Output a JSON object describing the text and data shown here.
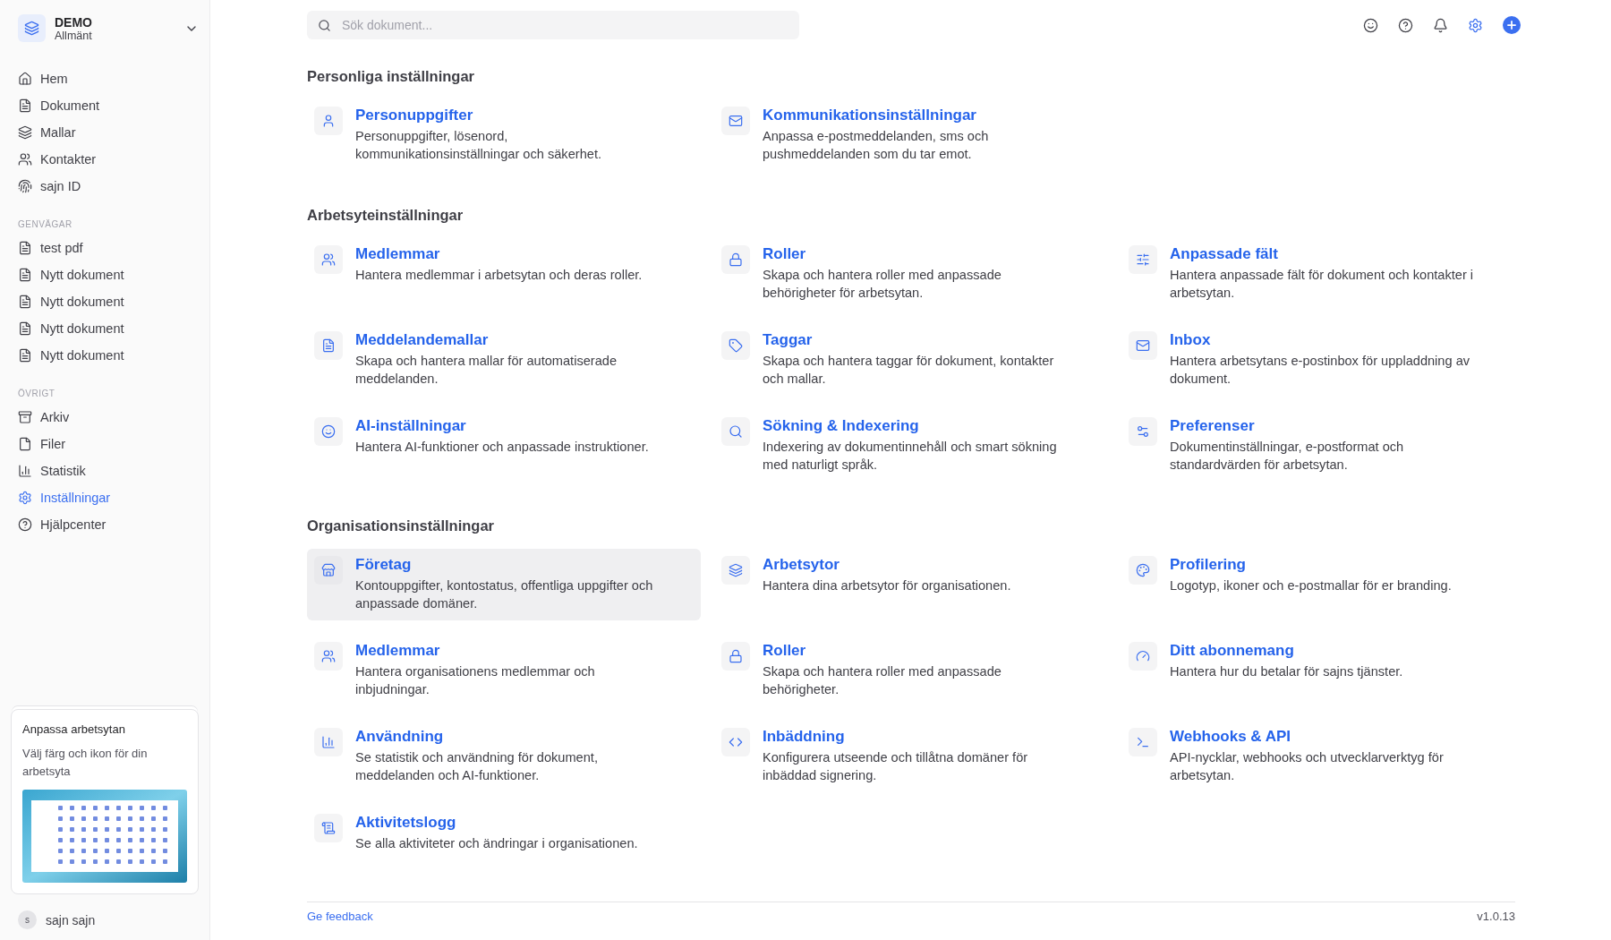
{
  "workspace": {
    "name": "DEMO",
    "subtitle": "Allmänt"
  },
  "nav": [
    {
      "label": "Hem",
      "selected": false
    },
    {
      "label": "Dokument",
      "selected": false
    },
    {
      "label": "Mallar",
      "selected": false
    },
    {
      "label": "Kontakter",
      "selected": false
    },
    {
      "label": "sajn ID",
      "selected": false
    }
  ],
  "shortcuts": {
    "heading": "GENVÄGAR",
    "items": [
      {
        "label": "test pdf",
        "selected": false
      },
      {
        "label": "Nytt dokument",
        "selected": false
      },
      {
        "label": "Nytt dokument",
        "selected": false
      },
      {
        "label": "Nytt dokument",
        "selected": false
      },
      {
        "label": "Nytt dokument",
        "selected": false
      }
    ]
  },
  "other": {
    "heading": "ÖVRIGT",
    "items": [
      {
        "label": "Arkiv",
        "selected": false
      },
      {
        "label": "Filer",
        "selected": false
      },
      {
        "label": "Statistik",
        "selected": false
      },
      {
        "label": "Inställningar",
        "selected": true
      },
      {
        "label": "Hjälpcenter",
        "selected": false
      }
    ]
  },
  "promo": {
    "title": "Anpassa arbetsytan",
    "text": "Välj färg och ikon för din arbetsyta"
  },
  "user": {
    "initial": "s",
    "name": "sajn sajn"
  },
  "search": {
    "placeholder": "Sök dokument..."
  },
  "toolbar": [
    {
      "selected": false
    },
    {
      "selected": false
    },
    {
      "selected": false
    },
    {
      "selected": true
    }
  ],
  "sections": [
    {
      "title": "Personliga inställningar",
      "cards": [
        {
          "title": "Personuppgifter",
          "description": "Personuppgifter, lösenord, kommunikationsinställningar och säkerhet.",
          "hovered": false
        },
        {
          "title": "Kommunikationsinställningar",
          "description": "Anpassa e-postmeddelanden, sms och pushmeddelanden som du tar emot.",
          "hovered": false
        }
      ]
    },
    {
      "title": "Arbetsyteinställningar",
      "cards": [
        {
          "title": "Medlemmar",
          "description": "Hantera medlemmar i arbetsytan och deras roller.",
          "hovered": false
        },
        {
          "title": "Roller",
          "description": "Skapa och hantera roller med anpassade behörigheter för arbetsytan.",
          "hovered": false
        },
        {
          "title": "Anpassade fält",
          "description": "Hantera anpassade fält för dokument och kontakter i arbetsytan.",
          "hovered": false
        },
        {
          "title": "Meddelandemallar",
          "description": "Skapa och hantera mallar för automatiserade meddelanden.",
          "hovered": false
        },
        {
          "title": "Taggar",
          "description": "Skapa och hantera taggar för dokument, kontakter och mallar.",
          "hovered": false
        },
        {
          "title": "Inbox",
          "description": "Hantera arbetsytans e-postinbox för uppladdning av dokument.",
          "hovered": false
        },
        {
          "title": "AI-inställningar",
          "description": "Hantera AI-funktioner och anpassade instruktioner.",
          "hovered": false
        },
        {
          "title": "Sökning & Indexering",
          "description": "Indexering av dokumentinnehåll och smart sökning med naturligt språk.",
          "hovered": false
        },
        {
          "title": "Preferenser",
          "description": "Dokumentinställningar, e-postformat och standardvärden för arbetsytan.",
          "hovered": false
        }
      ]
    },
    {
      "title": "Organisationsinställningar",
      "cards": [
        {
          "title": "Företag",
          "description": "Kontouppgifter, kontostatus, offentliga uppgifter och anpassade domäner.",
          "hovered": true
        },
        {
          "title": "Arbetsytor",
          "description": "Hantera dina arbetsytor för organisationen.",
          "hovered": false
        },
        {
          "title": "Profilering",
          "description": "Logotyp, ikoner och e-postmallar för er branding.",
          "hovered": false
        },
        {
          "title": "Medlemmar",
          "description": "Hantera organisationens medlemmar och inbjudningar.",
          "hovered": false
        },
        {
          "title": "Roller",
          "description": "Skapa och hantera roller med anpassade behörigheter.",
          "hovered": false
        },
        {
          "title": "Ditt abonnemang",
          "description": "Hantera hur du betalar för sajns tjänster.",
          "hovered": false
        },
        {
          "title": "Användning",
          "description": "Se statistik och användning för dokument, meddelanden och AI-funktioner.",
          "hovered": false
        },
        {
          "title": "Inbäddning",
          "description": "Konfigurera utseende och tillåtna domäner för inbäddad signering.",
          "hovered": false
        },
        {
          "title": "Webhooks & API",
          "description": "API-nycklar, webhooks och utvecklarverktyg för arbetsytan.",
          "hovered": false
        },
        {
          "title": "Aktivitetslogg",
          "description": "Se alla aktiviteter och ändringar i organisationen.",
          "hovered": false
        }
      ]
    }
  ],
  "footer": {
    "link": "Ge feedback",
    "version": "v1.0.13"
  }
}
